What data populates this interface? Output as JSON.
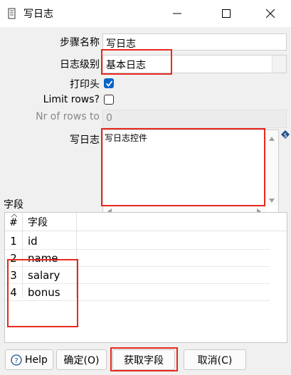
{
  "window": {
    "title": "写日志"
  },
  "form": {
    "step_name_label": "步骤名称",
    "step_name_value": "写日志",
    "log_level_label": "日志级别",
    "log_level_value": "基本日志",
    "print_header_label": "打印头",
    "print_header_checked": true,
    "limit_rows_label": "Limit rows?",
    "limit_rows_checked": false,
    "nr_rows_label": "Nr of rows to",
    "nr_rows_value": "0",
    "write_log_label": "写日志",
    "write_log_value": "写日志控件"
  },
  "fields": {
    "section_label": "字段",
    "col_num_header": "#",
    "col_name_header": "字段",
    "rows": [
      {
        "num": "1",
        "name": "id"
      },
      {
        "num": "2",
        "name": "name"
      },
      {
        "num": "3",
        "name": "salary"
      },
      {
        "num": "4",
        "name": "bonus"
      }
    ]
  },
  "buttons": {
    "help": "Help",
    "ok": "确定(O)",
    "get_fields": "获取字段",
    "cancel": "取消(C)"
  },
  "colors": {
    "highlight": "#e8281e",
    "accent": "#0a64c8",
    "help_icon": "#1f4e8c"
  }
}
